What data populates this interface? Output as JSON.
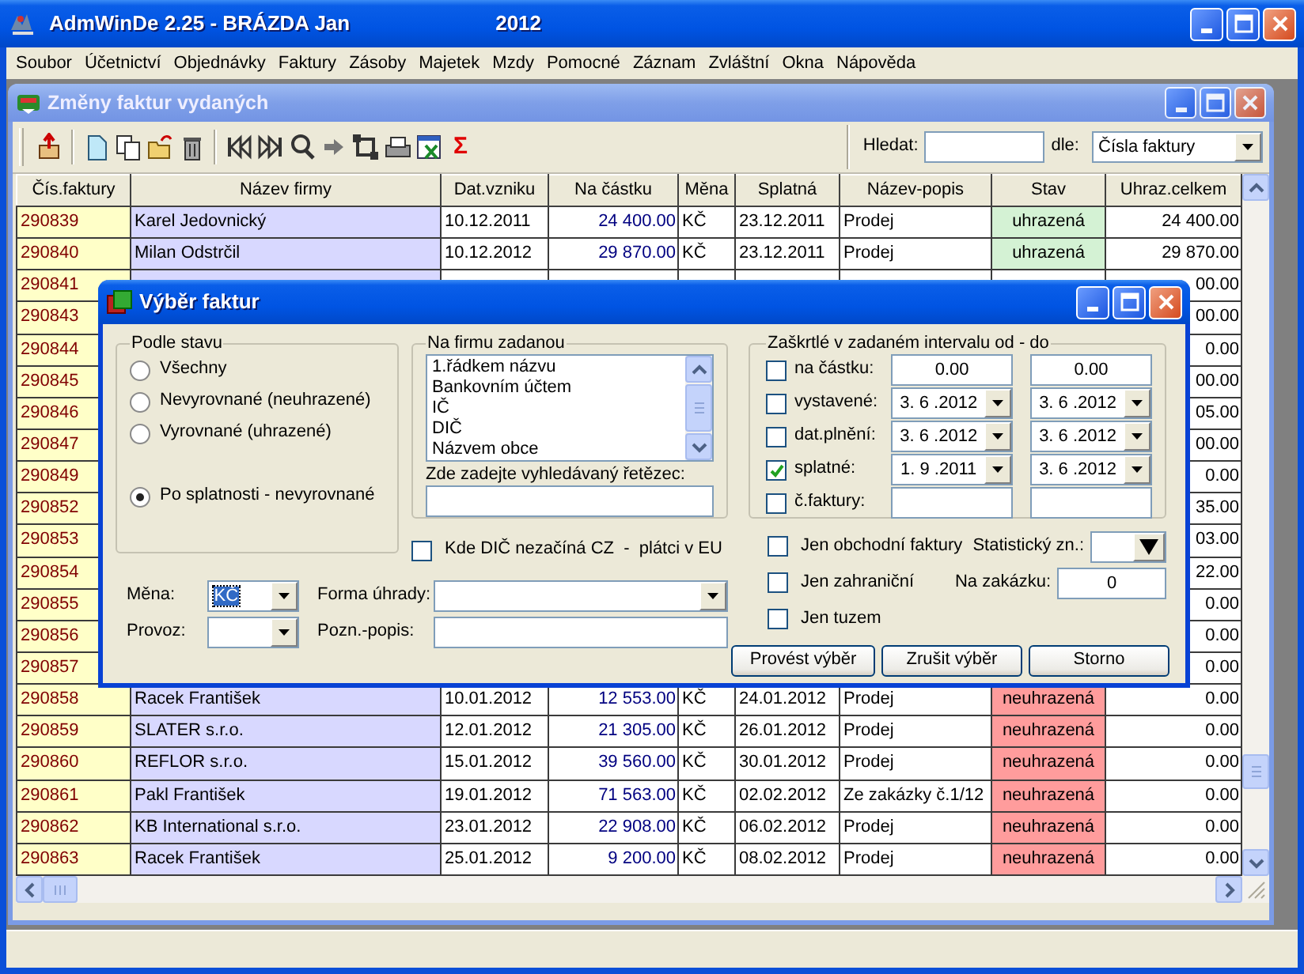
{
  "app_window": {
    "title": "AdmWinDe 2.25 - BRÁZDA Jan",
    "year": "2012"
  },
  "menu": [
    "Soubor",
    "Účetnictví",
    "Objednávky",
    "Faktury",
    "Zásoby",
    "Majetek",
    "Mzdy",
    "Pomocné",
    "Záznam",
    "Zvláštní",
    "Okna",
    "Nápověda"
  ],
  "child_window": {
    "title": "Změny faktur vydaných",
    "toolbar": {
      "sum_symbol": "Σ",
      "search_label": "Hledat:",
      "by_label": "dle:",
      "by_value": "Čísla faktury"
    },
    "columns": [
      "Čís.faktury",
      "Název firmy",
      "Dat.vzniku",
      "Na částku",
      "Měna",
      "Splatná",
      "Název-popis",
      "Stav",
      "Uhraz.celkem"
    ],
    "rows": [
      {
        "number": "290839",
        "firm": "Karel Jedovnický",
        "created": "10.12.2011",
        "amount": "24 400.00",
        "currency": "KČ",
        "due": "23.12.2011",
        "description": "Prodej",
        "status": "uhrazená",
        "paid": true,
        "total": "24 400.00"
      },
      {
        "number": "290840",
        "firm": "Milan Odstrčil",
        "created": "10.12.2012",
        "amount": "29 870.00",
        "currency": "KČ",
        "due": "23.12.2011",
        "description": "Prodej",
        "status": "uhrazená",
        "paid": true,
        "total": "29 870.00"
      },
      {
        "number": "290841",
        "total": "00.00"
      },
      {
        "number": "290843",
        "total": "00.00"
      },
      {
        "number": "290844",
        "total": "0.00"
      },
      {
        "number": "290845",
        "total": "00.00"
      },
      {
        "number": "290846",
        "total": "05.00"
      },
      {
        "number": "290847",
        "total": "00.00"
      },
      {
        "number": "290849",
        "total": "0.00"
      },
      {
        "number": "290852",
        "total": "35.00"
      },
      {
        "number": "290853",
        "total": "03.00"
      },
      {
        "number": "290854",
        "total": "22.00"
      },
      {
        "number": "290855",
        "total": "0.00"
      },
      {
        "number": "290856",
        "total": "0.00"
      },
      {
        "number": "290857",
        "total": "0.00"
      },
      {
        "number": "290858",
        "firm": "Racek František",
        "created": "10.01.2012",
        "amount": "12 553.00",
        "currency": "KČ",
        "due": "24.01.2012",
        "description": "Prodej",
        "status": "neuhrazená",
        "paid": false,
        "total": "0.00"
      },
      {
        "number": "290859",
        "firm": "SLATER s.r.o.",
        "created": "12.01.2012",
        "amount": "21 305.00",
        "currency": "KČ",
        "due": "26.01.2012",
        "description": "Prodej",
        "status": "neuhrazená",
        "paid": false,
        "total": "0.00"
      },
      {
        "number": "290860",
        "firm": "REFLOR s.r.o.",
        "created": "15.01.2012",
        "amount": "39 560.00",
        "currency": "KČ",
        "due": "30.01.2012",
        "description": "Prodej",
        "status": "neuhrazená",
        "paid": false,
        "total": "0.00"
      },
      {
        "number": "290861",
        "firm": "Pakl František",
        "created": "19.01.2012",
        "amount": "71 563.00",
        "currency": "KČ",
        "due": "02.02.2012",
        "description": "Ze zakázky č.1/12",
        "status": "neuhrazená",
        "paid": false,
        "total": "0.00"
      },
      {
        "number": "290862",
        "firm": "KB International s.r.o.",
        "created": "23.01.2012",
        "amount": "22 908.00",
        "currency": "KČ",
        "due": "06.02.2012",
        "description": "Prodej",
        "status": "neuhrazená",
        "paid": false,
        "total": "0.00"
      },
      {
        "number": "290863",
        "firm": "Racek František",
        "created": "25.01.2012",
        "amount": "9 200.00",
        "currency": "KČ",
        "due": "08.02.2012",
        "description": "Prodej",
        "status": "neuhrazená",
        "paid": false,
        "total": "0.00"
      }
    ]
  },
  "dialog": {
    "title": "Výběr faktur",
    "state_group": {
      "legend": "Podle stavu",
      "options": [
        {
          "label": "Všechny",
          "selected": false
        },
        {
          "label": "Nevyrovnané (neuhrazené)",
          "selected": false
        },
        {
          "label": "Vyrovnané (uhrazené)",
          "selected": false
        },
        {
          "label": "Po splatnosti - nevyrovnané",
          "selected": true
        }
      ]
    },
    "firm_group": {
      "legend": "Na firmu zadanou",
      "items": [
        "1.řádkem názvu",
        "Bankovním účtem",
        "IČ",
        "DIČ",
        "Názvem obce"
      ],
      "search_label": "Zde zadejte vyhledávaný řetězec:"
    },
    "eu_checkbox": {
      "label": "Kde DIČ nezačíná CZ  -  plátci v EU",
      "checked": false
    },
    "currency": {
      "label": "Měna:",
      "value": "KČ",
      "focused": true
    },
    "payment_form": {
      "label": "Forma úhrady:"
    },
    "branch": {
      "label": "Provoz:"
    },
    "note": {
      "label": "Pozn.-popis:"
    },
    "interval_group": {
      "legend": "Zaškrtlé v zadaném intervalu od - do",
      "rows": [
        {
          "kind": "amount",
          "label": "na částku:",
          "checked": false,
          "from": "0.00",
          "to": "0.00"
        },
        {
          "kind": "date",
          "label": "vystavené:",
          "checked": false,
          "from": "3. 6 .2012",
          "to": "3. 6 .2012"
        },
        {
          "kind": "date",
          "label": "dat.plnění:",
          "checked": false,
          "from": "3. 6 .2012",
          "to": "3. 6 .2012"
        },
        {
          "kind": "date",
          "label": "splatné:",
          "checked": true,
          "from": "1. 9 .2011",
          "to": "3. 6 .2012"
        },
        {
          "kind": "text",
          "label": "č.faktury:",
          "checked": false
        }
      ]
    },
    "options": [
      {
        "label": "Jen obchodní faktury",
        "checked": false
      },
      {
        "label": "Jen zahraniční",
        "checked": false
      },
      {
        "label": "Jen tuzem",
        "checked": false
      }
    ],
    "statistic": {
      "label": "Statistický zn.:"
    },
    "order": {
      "label": "Na zakázku:",
      "value": "0"
    },
    "buttons": [
      "Provést výběr",
      "Zrušit výběr",
      "Storno"
    ]
  }
}
